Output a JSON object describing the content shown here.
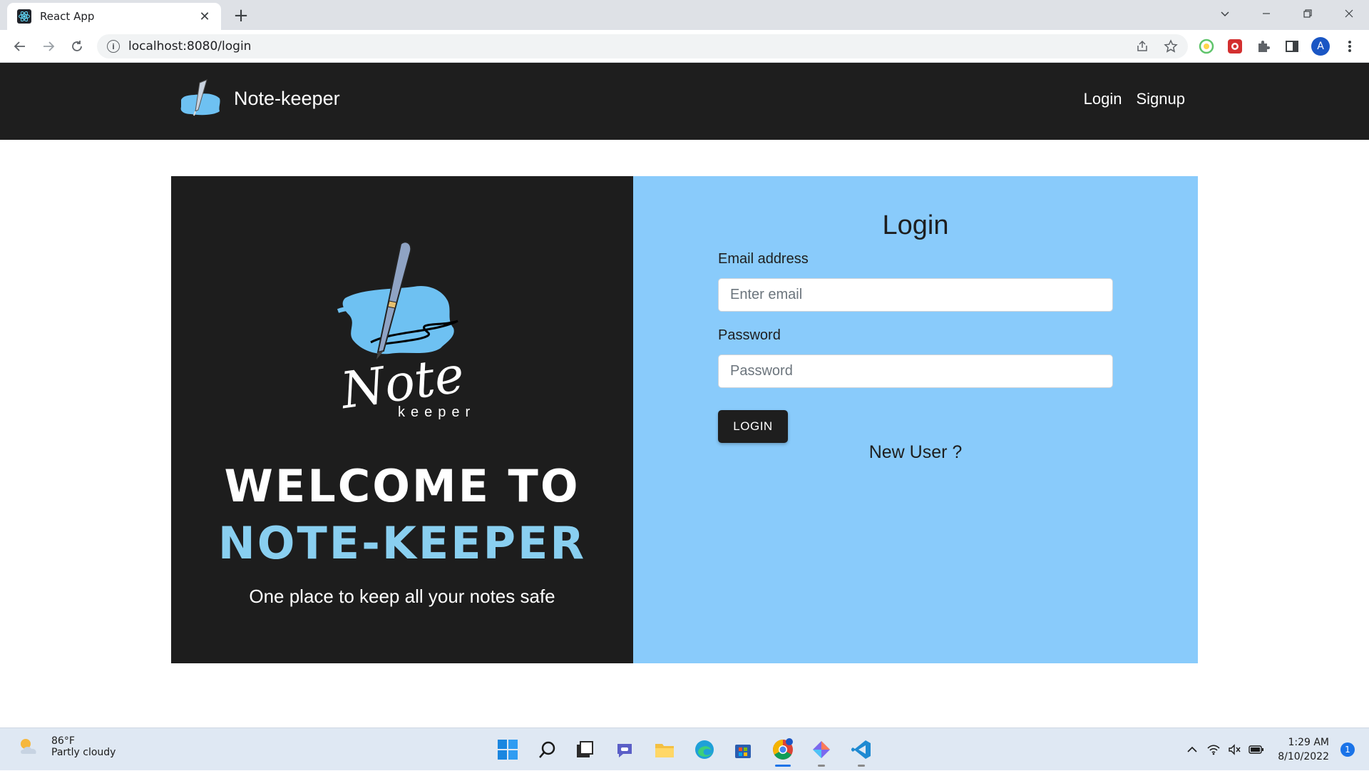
{
  "browser": {
    "tab_title": "React App",
    "url": "localhost:8080/login",
    "profile_initial": "A"
  },
  "app": {
    "brand_name": "Note-keeper",
    "nav": {
      "login": "Login",
      "signup": "Signup"
    }
  },
  "hero": {
    "logo_word": "Note",
    "logo_subword": "keeper",
    "welcome_line1": "WELCOME TO",
    "welcome_line2": "NOTE-KEEPER",
    "tagline": "One place to keep all your notes safe"
  },
  "form": {
    "title": "Login",
    "email_label": "Email address",
    "email_placeholder": "Enter email",
    "password_label": "Password",
    "password_placeholder": "Password",
    "submit_label": "LOGIN",
    "new_user_link": "New User ?"
  },
  "taskbar": {
    "weather_temp": "86°F",
    "weather_desc": "Partly cloudy",
    "time": "1:29 AM",
    "date": "8/10/2022",
    "notification_count": "1"
  },
  "colors": {
    "nav_bg": "#1e1e1e",
    "hero_bg": "#1d1d1d",
    "accent_blue": "#89cbfb",
    "welcome_highlight": "#89cff0"
  }
}
